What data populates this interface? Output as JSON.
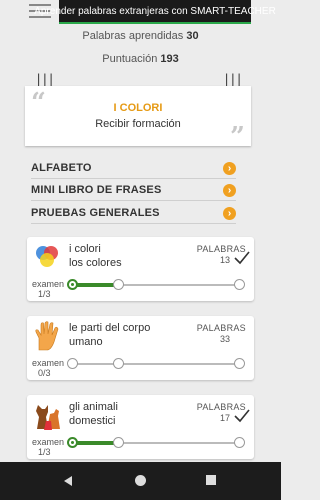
{
  "ad_banner": {
    "text": "Aprender palabras extranjeras con SMART-TEACHER"
  },
  "stats": {
    "words_label": "Palabras aprendidas",
    "words_value": "30",
    "score_label": "Puntuación",
    "score_value": "193"
  },
  "current_lesson": {
    "title": "I COLORI",
    "subtitle": "Recibir formación",
    "quote_open": "“",
    "quote_close": "”"
  },
  "menu": [
    {
      "label": "ALFABETO"
    },
    {
      "label": "MINI LIBRO DE FRASES"
    },
    {
      "label": "PRUEBAS GENERALES"
    }
  ],
  "words_header": "PALABRAS",
  "exam_label": "examen",
  "cards": [
    {
      "title": "i colori",
      "subtitle": "los colores",
      "words": "13",
      "exam": "1/3",
      "completed": true,
      "exam_progress": 0.333,
      "icon": "color-circles-icon"
    },
    {
      "title": "le parti del corpo",
      "subtitle": "umano",
      "words": "33",
      "exam": "0/3",
      "completed": false,
      "exam_progress": 0.0,
      "icon": "hand-icon"
    },
    {
      "title": "gli animali",
      "subtitle": "domestici",
      "words": "17",
      "exam": "1/3",
      "completed": true,
      "exam_progress": 0.333,
      "icon": "dog-cat-icon"
    }
  ],
  "colors": {
    "accent": "#e69a14",
    "progress": "#3a8a2a",
    "navbar": "#1c1c1c"
  }
}
